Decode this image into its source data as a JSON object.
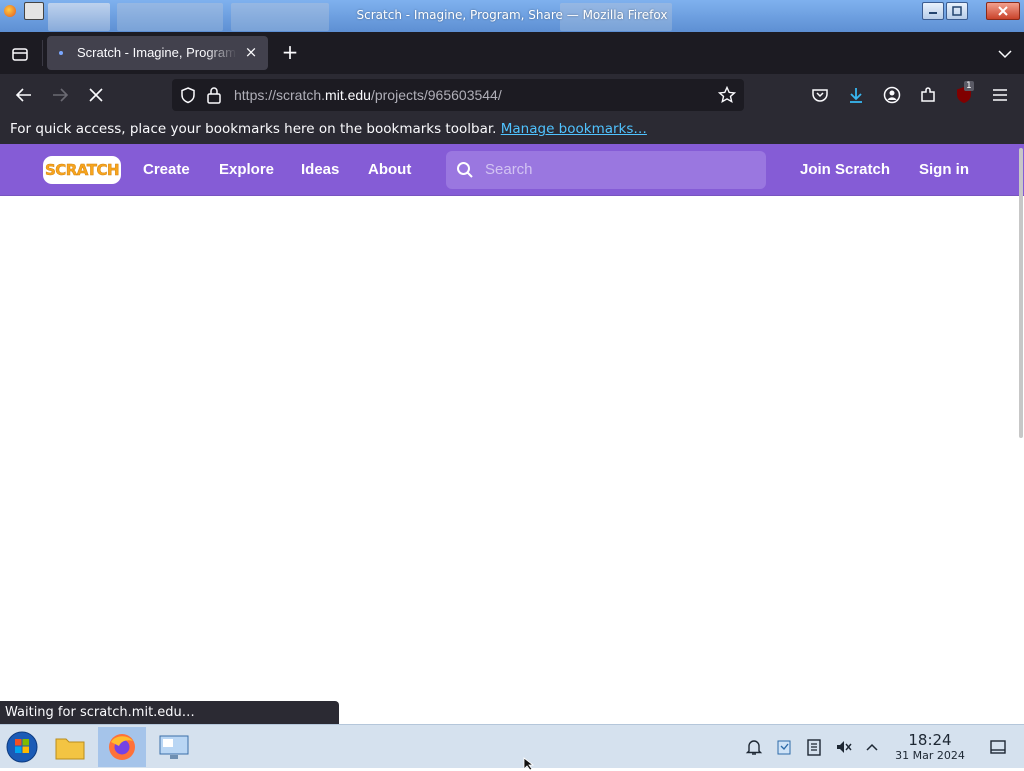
{
  "window": {
    "title": "Scratch - Imagine, Program, Share — Mozilla Firefox"
  },
  "tab": {
    "title": "Scratch - Imagine, Program, Share",
    "close": "×",
    "new_tab": "+"
  },
  "navbar": {
    "url_prefix": "https://scratch.",
    "url_host": "mit.edu",
    "url_path": "/projects/965603544/",
    "extension_badge": "1"
  },
  "bookmarks_bar": {
    "message": "For quick access, place your bookmarks here on the bookmarks toolbar.",
    "link": "Manage bookmarks…"
  },
  "scratch": {
    "logo": "SCRATCH",
    "nav": [
      "Create",
      "Explore",
      "Ideas",
      "About"
    ],
    "search_placeholder": "Search",
    "join": "Join Scratch",
    "signin": "Sign in",
    "brand_color": "#855cd6"
  },
  "status_text": "Waiting for scratch.mit.edu…",
  "taskbar": {
    "time": "18:24",
    "date": "31 Mar 2024"
  }
}
